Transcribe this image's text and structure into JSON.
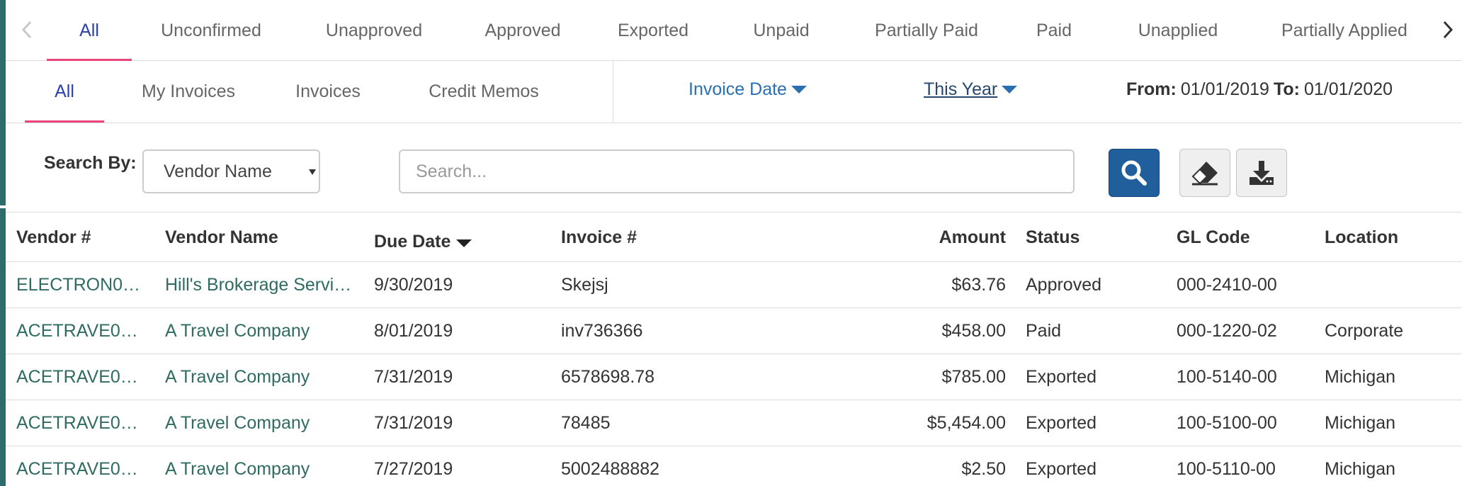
{
  "status_tabs": [
    {
      "label": "All",
      "active": true
    },
    {
      "label": "Unconfirmed",
      "active": false
    },
    {
      "label": "Unapproved",
      "active": false
    },
    {
      "label": "Approved",
      "active": false
    },
    {
      "label": "Exported",
      "active": false
    },
    {
      "label": "Unpaid",
      "active": false
    },
    {
      "label": "Partially Paid",
      "active": false
    },
    {
      "label": "Paid",
      "active": false
    },
    {
      "label": "Unapplied",
      "active": false
    },
    {
      "label": "Partially Applied",
      "active": false
    }
  ],
  "sub_tabs": [
    {
      "label": "All",
      "active": true
    },
    {
      "label": "My Invoices",
      "active": false
    },
    {
      "label": "Invoices",
      "active": false
    },
    {
      "label": "Credit Memos",
      "active": false
    }
  ],
  "filters": {
    "date_field": "Invoice Date",
    "period": "This Year",
    "from_label": "From:",
    "from_value": "01/01/2019",
    "to_label": "To:",
    "to_value": "01/01/2020"
  },
  "search": {
    "label": "Search By:",
    "field": "Vendor Name",
    "placeholder": "Search..."
  },
  "table": {
    "headers": {
      "vendor_no": "Vendor #",
      "vendor_name": "Vendor Name",
      "due_date": "Due Date",
      "invoice_no": "Invoice #",
      "amount": "Amount",
      "status": "Status",
      "gl_code": "GL Code",
      "location": "Location"
    },
    "rows": [
      {
        "vendor_no": "ELECTRON0…",
        "vendor_name": "Hill's Brokerage Servi…",
        "due_date": "9/30/2019",
        "invoice_no": "Skejsj",
        "amount": "$63.76",
        "status": "Approved",
        "gl_code": "000-2410-00",
        "location": ""
      },
      {
        "vendor_no": "ACETRAVE0…",
        "vendor_name": "A Travel Company",
        "due_date": "8/01/2019",
        "invoice_no": "inv736366",
        "amount": "$458.00",
        "status": "Paid",
        "gl_code": "000-1220-02",
        "location": "Corporate"
      },
      {
        "vendor_no": "ACETRAVE0…",
        "vendor_name": "A Travel Company",
        "due_date": "7/31/2019",
        "invoice_no": "6578698.78",
        "amount": "$785.00",
        "status": "Exported",
        "gl_code": "100-5140-00",
        "location": "Michigan"
      },
      {
        "vendor_no": "ACETRAVE0…",
        "vendor_name": "A Travel Company",
        "due_date": "7/31/2019",
        "invoice_no": "78485",
        "amount": "$5,454.00",
        "status": "Exported",
        "gl_code": "100-5100-00",
        "location": "Michigan"
      },
      {
        "vendor_no": "ACETRAVE0…",
        "vendor_name": "A Travel Company",
        "due_date": "7/27/2019",
        "invoice_no": "5002488882",
        "amount": "$2.50",
        "status": "Exported",
        "gl_code": "100-5110-00",
        "location": "Michigan"
      }
    ]
  },
  "colors": {
    "accent_underline": "#e8457a",
    "active_tab": "#2b3fa8",
    "link": "#2a6fb0",
    "table_link": "#2f6b62",
    "primary_button": "#215f9c"
  },
  "icons": {
    "prev": "chevron-left-icon",
    "next": "chevron-right-icon",
    "search": "magnifier-icon",
    "clear": "eraser-icon",
    "export": "download-icon"
  }
}
